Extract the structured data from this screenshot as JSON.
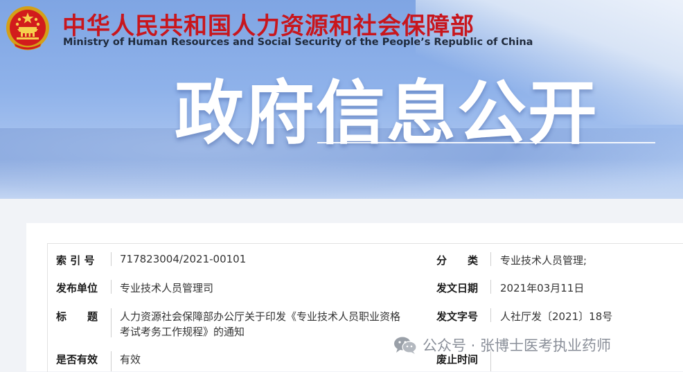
{
  "header": {
    "title_cn": "中华人民共和国人力资源和社会保障部",
    "title_en": "Ministry of Human Resources and Social Security of the People’s Republic of China",
    "banner_title": "政府信息公开"
  },
  "info": {
    "index_label": "索 引 号",
    "index_value": "717823004/2021-00101",
    "category_label": "分　　类",
    "category_value": "专业技术人员管理;",
    "issuer_label": "发布单位",
    "issuer_value": "专业技术人员管理司",
    "date_label": "发文日期",
    "date_value": "2021年03月11日",
    "title_label": "标　　题",
    "title_line1": "人力资源社会保障部办公厅关于印发《专业技术人员职业资格",
    "title_line2": "考试考务工作规程》的通知",
    "docno_label": "发文字号",
    "docno_value": "人社厅发〔2021〕18号",
    "valid_label": "是否有效",
    "valid_value": "有效",
    "abolish_label": "废止时间"
  },
  "watermark": {
    "text": "公众号 · 张博士医考执业药师",
    "icon": "wechat-icon"
  },
  "colors": {
    "brand_red": "#c8161d",
    "banner_blue": "#8fb2ea"
  }
}
